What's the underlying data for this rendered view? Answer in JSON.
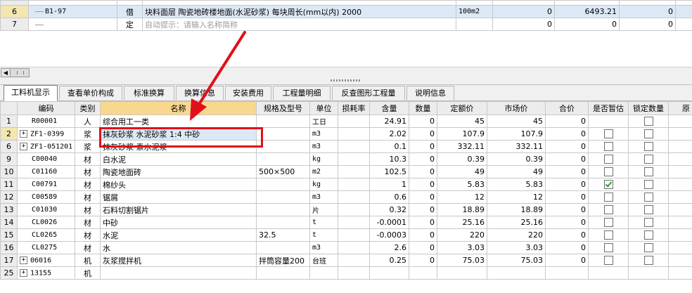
{
  "top_grid": {
    "rows": [
      {
        "num": "6",
        "code": "B1-97",
        "type": "借",
        "name": "块料面层 陶瓷地砖楼地面(水泥砂浆) 每块周长(mm以内) 2000",
        "unit": "100m2",
        "qty": "0",
        "price": "6493.21",
        "total": "0"
      },
      {
        "num": "7",
        "code": "",
        "type": "定",
        "hint": "自动提示：请输入名称简称",
        "unit": "",
        "qty": "0",
        "price": "0",
        "total": "0"
      }
    ]
  },
  "tabs": [
    "工料机显示",
    "查看单价构成",
    "标准换算",
    "换算信息",
    "安装费用",
    "工程量明细",
    "反查图形工程量",
    "说明信息"
  ],
  "columns": [
    "编码",
    "类别",
    "名称",
    "规格及型号",
    "单位",
    "损耗率",
    "含量",
    "数量",
    "定额价",
    "市场价",
    "合价",
    "是否暂估",
    "锁定数量",
    "原"
  ],
  "rows": [
    {
      "num": "1",
      "expand": "",
      "code": "R00001",
      "cat": "人",
      "name": "综合用工一类",
      "spec": "",
      "unit": "工日",
      "loss": "",
      "content": "24.91",
      "qty": "0",
      "quota": "45",
      "market": "45",
      "total": "0",
      "provisional": "none",
      "locked": "box"
    },
    {
      "num": "2",
      "expand": "+",
      "code": "ZF1-0399",
      "cat": "浆",
      "name": "抹灰砂浆 水泥砂浆 1:4 中砂",
      "spec": "",
      "unit": "m3",
      "loss": "",
      "content": "2.02",
      "qty": "0",
      "quota": "107.9",
      "market": "107.9",
      "total": "0",
      "provisional": "box",
      "locked": "box"
    },
    {
      "num": "6",
      "expand": "+",
      "code": "ZF1-051201",
      "cat": "浆",
      "name": "抹灰砂浆 素水泥浆",
      "spec": "",
      "unit": "m3",
      "loss": "",
      "content": "0.1",
      "qty": "0",
      "quota": "332.11",
      "market": "332.11",
      "total": "0",
      "provisional": "box",
      "locked": "box"
    },
    {
      "num": "9",
      "expand": "",
      "code": "C00040",
      "cat": "材",
      "name": "白水泥",
      "spec": "",
      "unit": "kg",
      "loss": "",
      "content": "10.3",
      "qty": "0",
      "quota": "0.39",
      "market": "0.39",
      "total": "0",
      "provisional": "box",
      "locked": "box"
    },
    {
      "num": "10",
      "expand": "",
      "code": "C01160",
      "cat": "材",
      "name": "陶瓷地面砖",
      "spec": "500×500",
      "unit": "m2",
      "loss": "",
      "content": "102.5",
      "qty": "0",
      "quota": "49",
      "market": "49",
      "total": "0",
      "provisional": "box",
      "locked": "box"
    },
    {
      "num": "11",
      "expand": "",
      "code": "C00791",
      "cat": "材",
      "name": "棉纱头",
      "spec": "",
      "unit": "kg",
      "loss": "",
      "content": "1",
      "qty": "0",
      "quota": "5.83",
      "market": "5.83",
      "total": "0",
      "provisional": "on",
      "locked": "box"
    },
    {
      "num": "12",
      "expand": "",
      "code": "C00589",
      "cat": "材",
      "name": "锯屑",
      "spec": "",
      "unit": "m3",
      "loss": "",
      "content": "0.6",
      "qty": "0",
      "quota": "12",
      "market": "12",
      "total": "0",
      "provisional": "box",
      "locked": "box"
    },
    {
      "num": "13",
      "expand": "",
      "code": "C01030",
      "cat": "材",
      "name": "石料切割锯片",
      "spec": "",
      "unit": "片",
      "loss": "",
      "content": "0.32",
      "qty": "0",
      "quota": "18.89",
      "market": "18.89",
      "total": "0",
      "provisional": "box",
      "locked": "box"
    },
    {
      "num": "14",
      "expand": "",
      "code": "CL0026",
      "cat": "材",
      "name": "中砂",
      "spec": "",
      "unit": "t",
      "loss": "",
      "content": "-0.0001",
      "qty": "0",
      "quota": "25.16",
      "market": "25.16",
      "total": "0",
      "provisional": "box",
      "locked": "box"
    },
    {
      "num": "15",
      "expand": "",
      "code": "CL0265",
      "cat": "材",
      "name": "水泥",
      "spec": "32.5",
      "unit": "t",
      "loss": "",
      "content": "-0.0003",
      "qty": "0",
      "quota": "220",
      "market": "220",
      "total": "0",
      "provisional": "box",
      "locked": "box"
    },
    {
      "num": "16",
      "expand": "",
      "code": "CL0275",
      "cat": "材",
      "name": "水",
      "spec": "",
      "unit": "m3",
      "loss": "",
      "content": "2.6",
      "qty": "0",
      "quota": "3.03",
      "market": "3.03",
      "total": "0",
      "provisional": "box",
      "locked": "box"
    },
    {
      "num": "17",
      "expand": "+",
      "code": "06016",
      "cat": "机",
      "name": "灰浆搅拌机",
      "spec": "拌筒容量200",
      "unit": "台班",
      "loss": "",
      "content": "0.25",
      "qty": "0",
      "quota": "75.03",
      "market": "75.03",
      "total": "0",
      "provisional": "box",
      "locked": "box"
    },
    {
      "num": "25",
      "expand": "+",
      "code": "13155",
      "cat": "机",
      "name": "",
      "spec": "",
      "unit": "",
      "loss": "",
      "content": "",
      "qty": "",
      "quota": "",
      "market": "",
      "total": "",
      "provisional": "none",
      "locked": "none"
    }
  ],
  "colors": {
    "annotation": "#e0101a",
    "selection": "#dde8f6",
    "name_header": "#f8d78e"
  }
}
